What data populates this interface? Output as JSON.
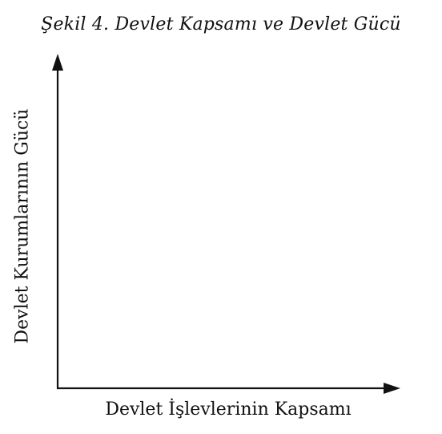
{
  "figure": {
    "title": "Şekil 4. Devlet Kapsamı ve Devlet Gücü",
    "x_axis_label": "Devlet İşlevlerinin Kapsamı",
    "y_axis_label": "Devlet Kurumlarının Gücü"
  },
  "colors": {
    "ink": "#111111",
    "background": "#ffffff"
  }
}
